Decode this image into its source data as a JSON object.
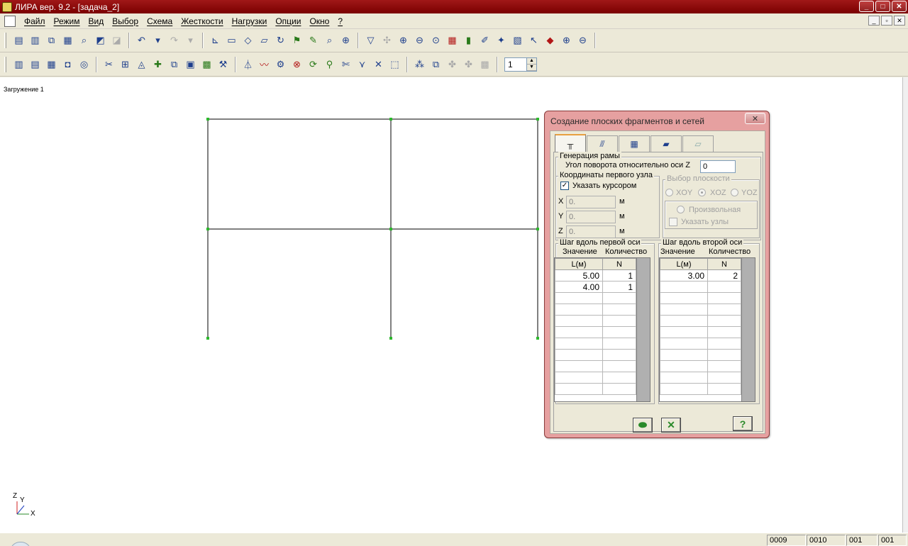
{
  "window": {
    "title": "ЛИРА  вер. 9.2 - [задача_2]",
    "controls": [
      "_",
      "□",
      "✕"
    ]
  },
  "menu": [
    "Файл",
    "Режим",
    "Вид",
    "Выбор",
    "Схема",
    "Жесткости",
    "Нагрузки",
    "Опции",
    "Окно",
    "?"
  ],
  "mdi_controls": [
    "_",
    "▫",
    "✕"
  ],
  "toolbar": {
    "spin_value": "1"
  },
  "canvas": {
    "load_case": "Загружение  1",
    "axis_z": "Z",
    "axis_y": "Y",
    "axis_x": "X"
  },
  "status": [
    "0009",
    "0010",
    "001",
    "001"
  ],
  "dialog": {
    "title": "Создание плоских фрагментов и сетей",
    "close": "✕",
    "group_frame": "Генерация  рамы",
    "angle_label": "Угол поворота относительно оси Z",
    "angle_value": "0",
    "group_first_node": "Координаты первого узла",
    "cursor_checkbox": "Указать курсором",
    "cursor_checked": "✓",
    "coords": [
      {
        "axis": "X",
        "value": "0.",
        "unit": "м"
      },
      {
        "axis": "Y",
        "value": "0.",
        "unit": "м"
      },
      {
        "axis": "Z",
        "value": "0.",
        "unit": "м"
      }
    ],
    "group_plane": "Выбор плоскости",
    "planes": [
      "XOY",
      "XOZ",
      "YOZ"
    ],
    "arbitrary": "Произвольная",
    "nodes_checkbox": "Указать узлы",
    "group_step1": "Шаг вдоль первой оси",
    "group_step2": "Шаг вдоль второй оси",
    "col_value": "Значение",
    "col_count": "Количество",
    "col_l": "L(м)",
    "col_n": "N",
    "step1_rows": [
      {
        "l": "5.00",
        "n": "1"
      },
      {
        "l": "4.00",
        "n": "1"
      }
    ],
    "step2_rows": [
      {
        "l": "3.00",
        "n": "2"
      }
    ],
    "help": "?"
  }
}
